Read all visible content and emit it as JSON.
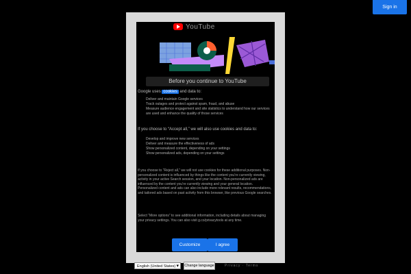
{
  "header": {
    "signin_label": "Sign in"
  },
  "brand": {
    "name": "YouTube",
    "accent": "#ff0000"
  },
  "dialog": {
    "title": "Before you continue to YouTube",
    "section1_intro_a": "Google uses",
    "section1_highlight": "cookies",
    "section1_intro_b": "and data to:",
    "section1_bullets": [
      "Deliver and maintain Google services",
      "Track outages and protect against spam, fraud, and abuse",
      "Measure audience engagement and site statistics to understand how our services are used and enhance the quality of those services"
    ],
    "section2_intro": "If you choose to “Accept all,” we will also use cookies and data to:",
    "section2_bullets": [
      "Develop and improve new services",
      "Deliver and measure the effectiveness of ads",
      "Show personalized content, depending on your settings",
      "Show personalized ads, depending on your settings"
    ],
    "para1": "If you choose to “Reject all,” we will not use cookies for these additional purposes. Non-personalized content is influenced by things like the content you’re currently viewing, activity in your active Search session, and your location. Non-personalized ads are influenced by the content you’re currently viewing and your general location. Personalized content and ads can also include more relevant results, recommendations, and tailored ads based on past activity from this browser, like previous Google searches.",
    "para2": "Select “More options” to see additional information, including details about managing your privacy settings. You can also visit g.co/privacytools at any time.",
    "customize_label": "Customize",
    "agree_label": "I agree",
    "button_color": "#1a73e8"
  },
  "footer": {
    "language_value": "English (United States)",
    "change_language_label": "Change language",
    "links": "Privacy · Terms"
  }
}
